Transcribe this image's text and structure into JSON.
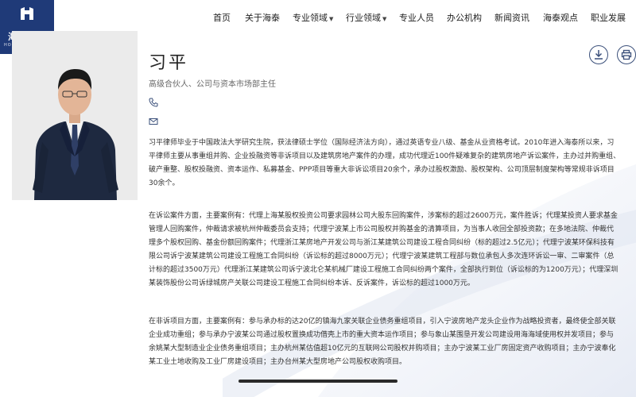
{
  "logo": {
    "name": "海泰律师",
    "sub": "HOITAC LAWYERS"
  },
  "nav": [
    {
      "label": "首页",
      "has_caret": false
    },
    {
      "label": "关于海泰",
      "has_caret": false
    },
    {
      "label": "专业领域",
      "has_caret": true
    },
    {
      "label": "行业领域",
      "has_caret": true
    },
    {
      "label": "专业人员",
      "has_caret": false
    },
    {
      "label": "办公机构",
      "has_caret": false
    },
    {
      "label": "新闻资讯",
      "has_caret": false
    },
    {
      "label": "海泰观点",
      "has_caret": false
    },
    {
      "label": "职业发展",
      "has_caret": false
    }
  ],
  "profile": {
    "name": "习平",
    "title": "高级合伙人、公司与资本市场部主任"
  },
  "icons": {
    "phone": "phone-icon",
    "email": "email-icon",
    "download": "download-icon",
    "print": "print-icon"
  },
  "colors": {
    "brand": "#1f3a78",
    "text": "#333333"
  },
  "bio": {
    "lines": [
      "习平律师毕业于中国政法大学研究生院，获法律硕士学位（国际经济法方向），通过英语专业八级、基金从业资格考试。2010年进入海泰所以来，习",
      "平律师主要从事重组并购、企业投融资等非诉项目以及建筑房地产案件的办理，成功代理近100件疑难复杂的建筑房地产诉讼案件，主办过并购重组、",
      "破产重整、股权投融资、资本运作、私募基金、PPP项目等重大非诉讼项目20余个，承办过股权激励、股权架构、公司顶层制度架构等常规非诉项目",
      "30余个。"
    ]
  },
  "litigation": {
    "lines": [
      "在诉讼案件方面，主要案例有：代理上海某股权投资公司要求园林公司大股东回购案件，涉案标的超过2600万元，案件胜诉；代理某投资人要求基金",
      "管理人回购案件，仲裁请求被杭州仲裁委员会支持；代理宁波某上市公司股权并购基金的清算项目，为当事人收回全部投资款；在多地法院、仲裁代",
      "理多个股权回购、基金份额回购案件；代理浙江某房地产开发公司与浙江某建筑公司建设工程合同纠纷（标的超过2.5亿元）；代理宁波某环保科技有",
      "限公司诉宁波某建筑公司建设工程施工合同纠纷（诉讼标的超过8000万元）；代理宁波某建筑工程部与数位承包人多次连环诉讼一审、二审案件（总",
      "计标的超过3500万元）代理浙江某建筑公司诉宁波北仑某机械厂建设工程施工合同纠纷两个案件，全部执行到位（诉讼标的为1200万元）；代理深圳",
      "某装饰股份公司诉绿城房产关联公司建设工程施工合同纠纷本诉、反诉案件，诉讼标的超过1000万元。"
    ]
  },
  "non_litigation": {
    "lines": [
      "在非诉项目方面，主要案例有：参与承办标的达20亿的镇海九家关联企业债务重组项目，引入宁波房地产龙头企业作为战略投资者，最终使全部关联",
      "企业成功重组；参与承办宁波某公司通过股权置换成功借壳上市的重大资本运作项目；参与象山某围垦开发公司建设用海海域使用权并发项目；参与",
      "余姚某大型制造业企业债务重组项目；主办杭州某估值超10亿元的互联网公司股权并购项目；主办宁波某工业厂房固定资产收购项目；主办宁波奉化",
      "某工业土地收购及工业厂房建设项目；主办台州某大型房地产公司股权收购项目。"
    ]
  }
}
